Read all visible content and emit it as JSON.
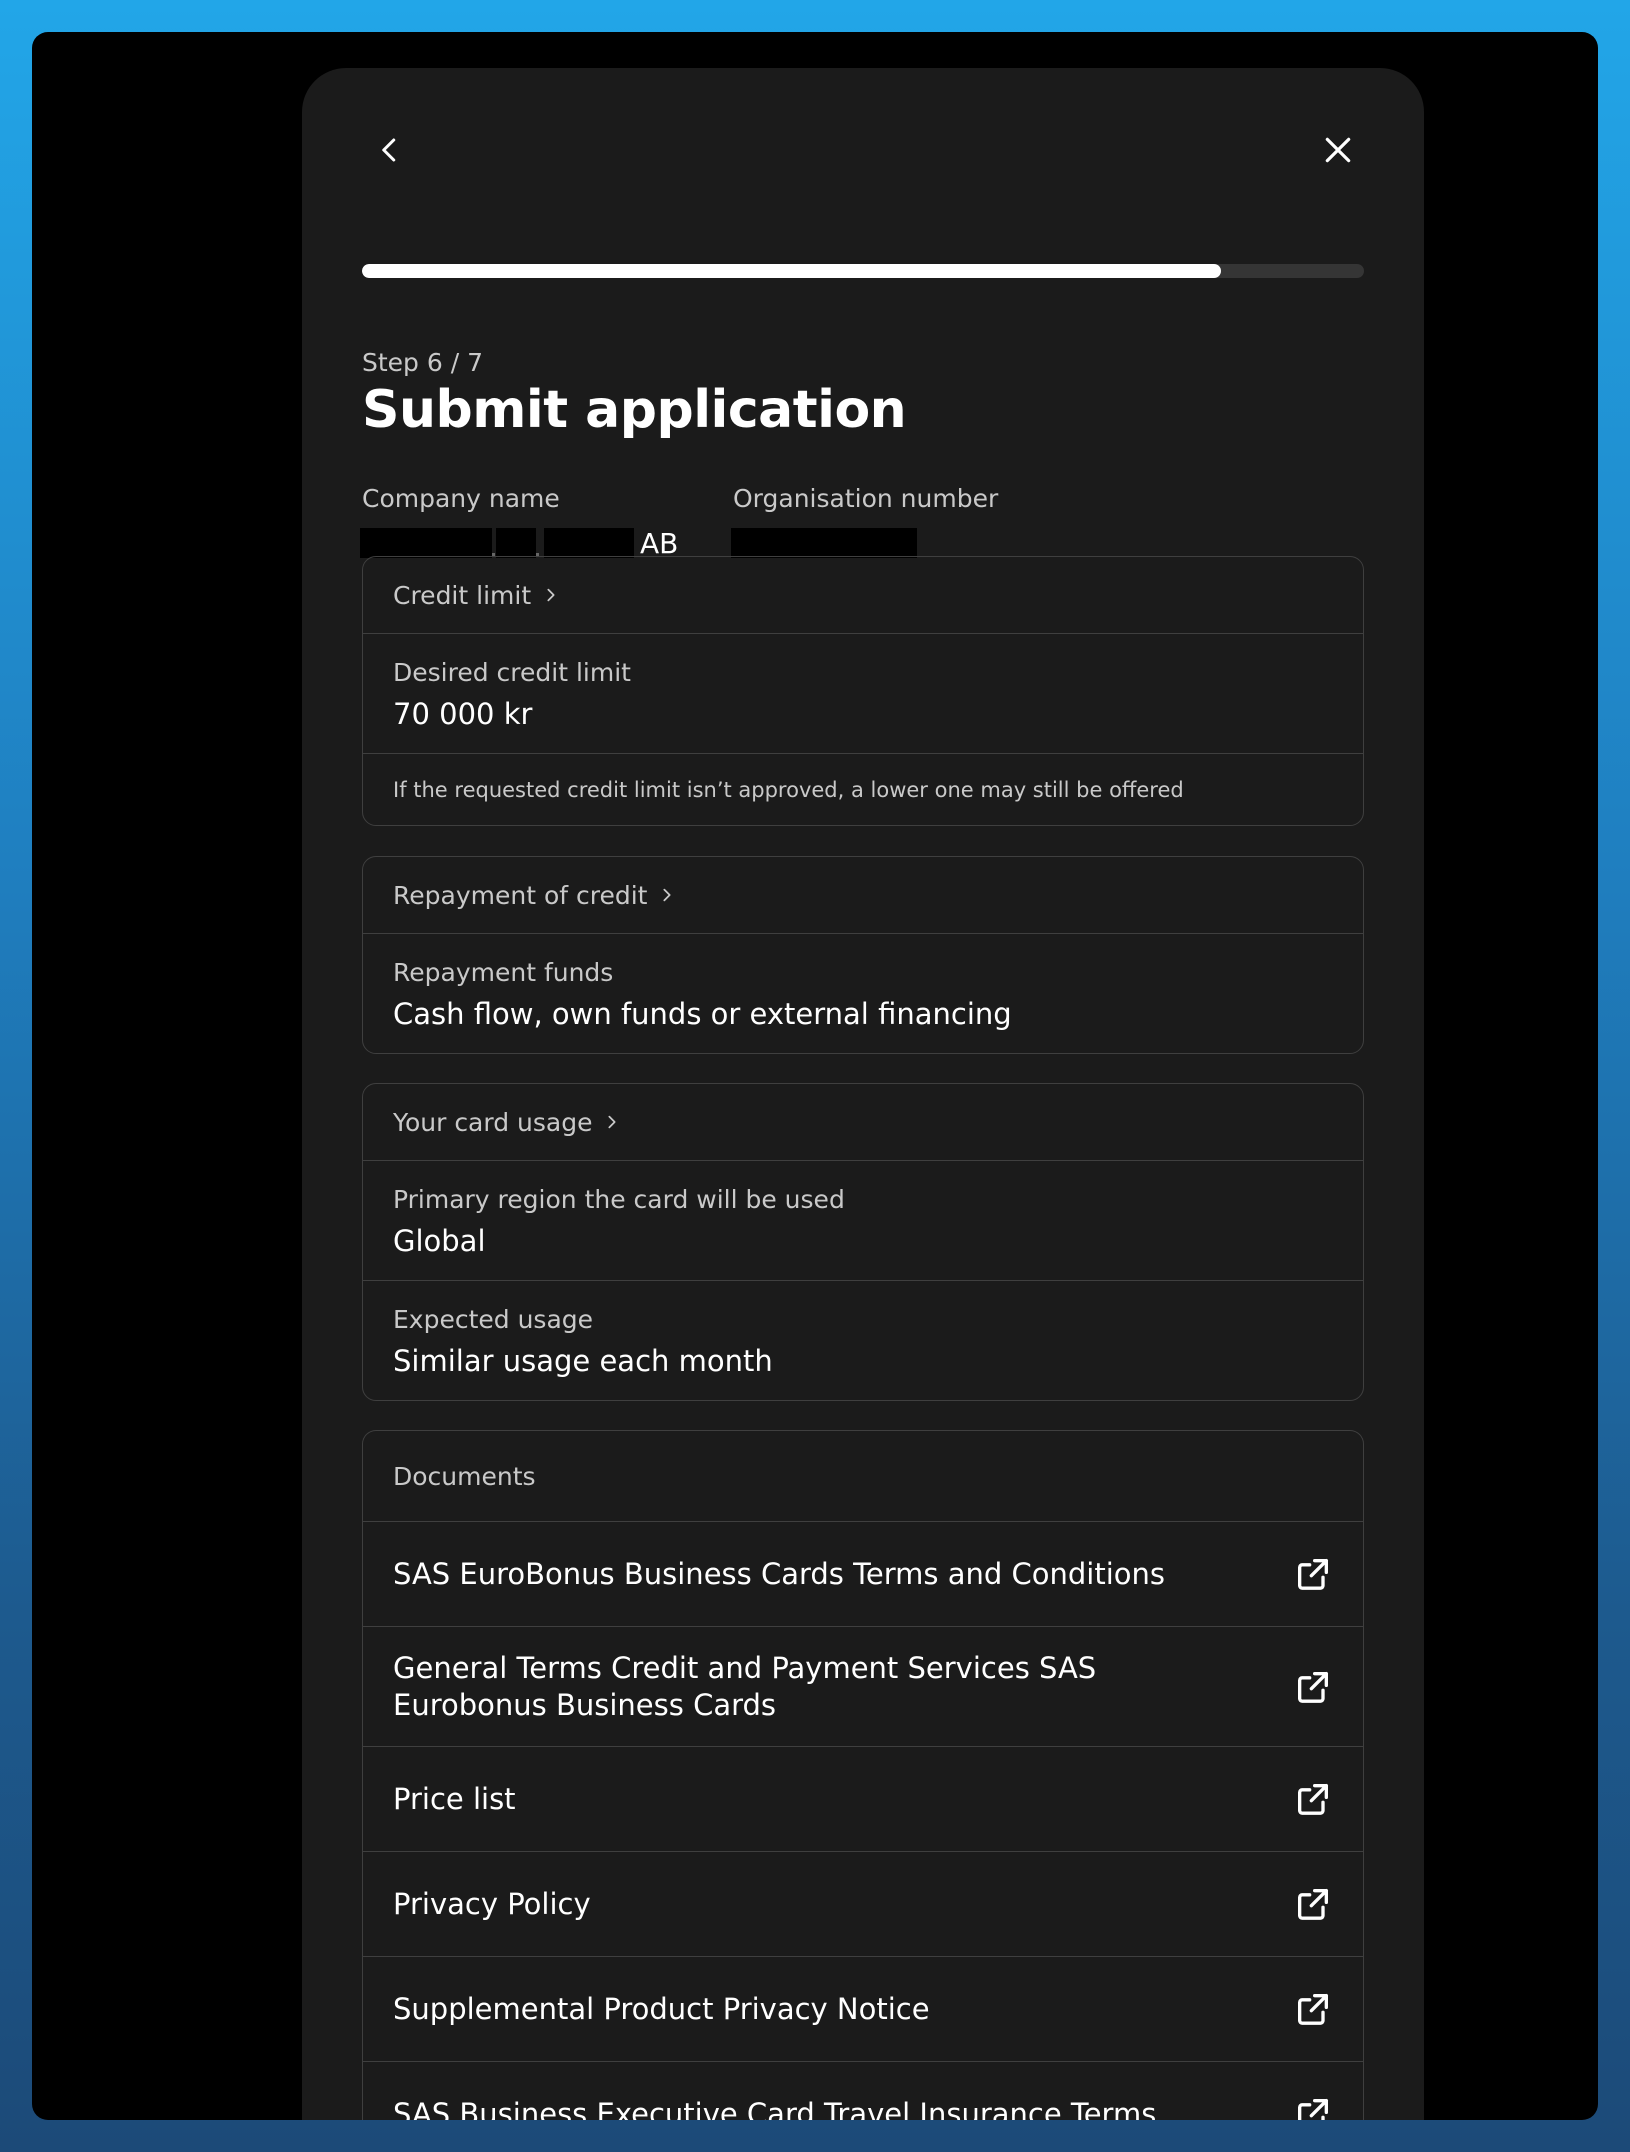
{
  "progress": {
    "current": 6,
    "total": 7,
    "fill_fraction": 0.857
  },
  "header": {
    "step_label": "Step 6 / 7",
    "title": "Submit application"
  },
  "company": {
    "name_label": "Company name",
    "name_suffix": "AB",
    "org_label": "Organisation number"
  },
  "credit_limit": {
    "header": "Credit limit",
    "desired_label": "Desired credit limit",
    "desired_value": "70 000 kr",
    "note": "If the requested credit limit isn’t approved, a lower one may still be offered"
  },
  "repayment": {
    "header": "Repayment of credit",
    "funds_label": "Repayment funds",
    "funds_value": "Cash flow, own funds or external financing"
  },
  "card_usage": {
    "header": "Your card usage",
    "region_label": "Primary region the card will be used",
    "region_value": "Global",
    "usage_label": "Expected usage",
    "usage_value": "Similar usage each month"
  },
  "documents": {
    "header": "Documents",
    "items": [
      {
        "label": "SAS EuroBonus Business Cards Terms and Conditions"
      },
      {
        "label": "General Terms Credit and Payment Services SAS Eurobonus Business Cards"
      },
      {
        "label": "Price list"
      },
      {
        "label": "Privacy Policy"
      },
      {
        "label": "Supplemental Product Privacy Notice"
      },
      {
        "label": "SAS Business Executive Card Travel Insurance Terms"
      }
    ]
  },
  "icons": {
    "back": "chevron-left-icon",
    "close": "close-icon",
    "section": "chevron-right-icon",
    "document": "external-link-icon"
  },
  "colors": {
    "panel": "#1b1b1b",
    "border": "#3f3f3f",
    "progress_fill": "#ffffff",
    "progress_track": "#353535",
    "text_primary": "#ffffff",
    "text_secondary": "#c9c9c9"
  }
}
